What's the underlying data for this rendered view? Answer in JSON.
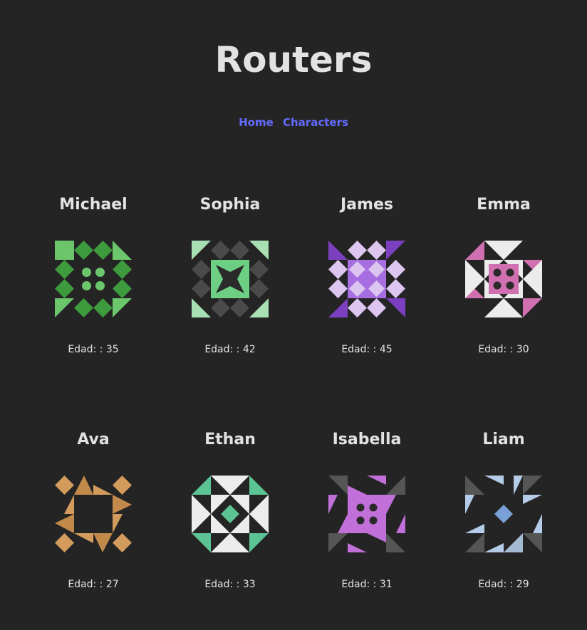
{
  "header": {
    "title": "Routers"
  },
  "nav": {
    "items": [
      {
        "label": "Home"
      },
      {
        "label": "Characters"
      }
    ]
  },
  "age_label": "Edad: :",
  "characters": [
    {
      "name": "Michael",
      "age": 35,
      "age_text": "Edad: : 35",
      "avatar": "green-pattern-avatar"
    },
    {
      "name": "Sophia",
      "age": 42,
      "age_text": "Edad: : 42",
      "avatar": "mint-pattern-avatar"
    },
    {
      "name": "James",
      "age": 45,
      "age_text": "Edad: : 45",
      "avatar": "purple-pattern-avatar"
    },
    {
      "name": "Emma",
      "age": 30,
      "age_text": "Edad: : 30",
      "avatar": "pink-pattern-avatar"
    },
    {
      "name": "Ava",
      "age": 27,
      "age_text": "Edad: : 27",
      "avatar": "tan-pattern-avatar"
    },
    {
      "name": "Ethan",
      "age": 33,
      "age_text": "Edad: : 33",
      "avatar": "teal-pattern-avatar"
    },
    {
      "name": "Isabella",
      "age": 31,
      "age_text": "Edad: : 31",
      "avatar": "orchid-pattern-avatar"
    },
    {
      "name": "Liam",
      "age": 29,
      "age_text": "Edad: : 29",
      "avatar": "blue-pattern-avatar"
    }
  ],
  "colors": {
    "background": "#242424",
    "link": "#646cff",
    "text": "#e0e0e0"
  }
}
